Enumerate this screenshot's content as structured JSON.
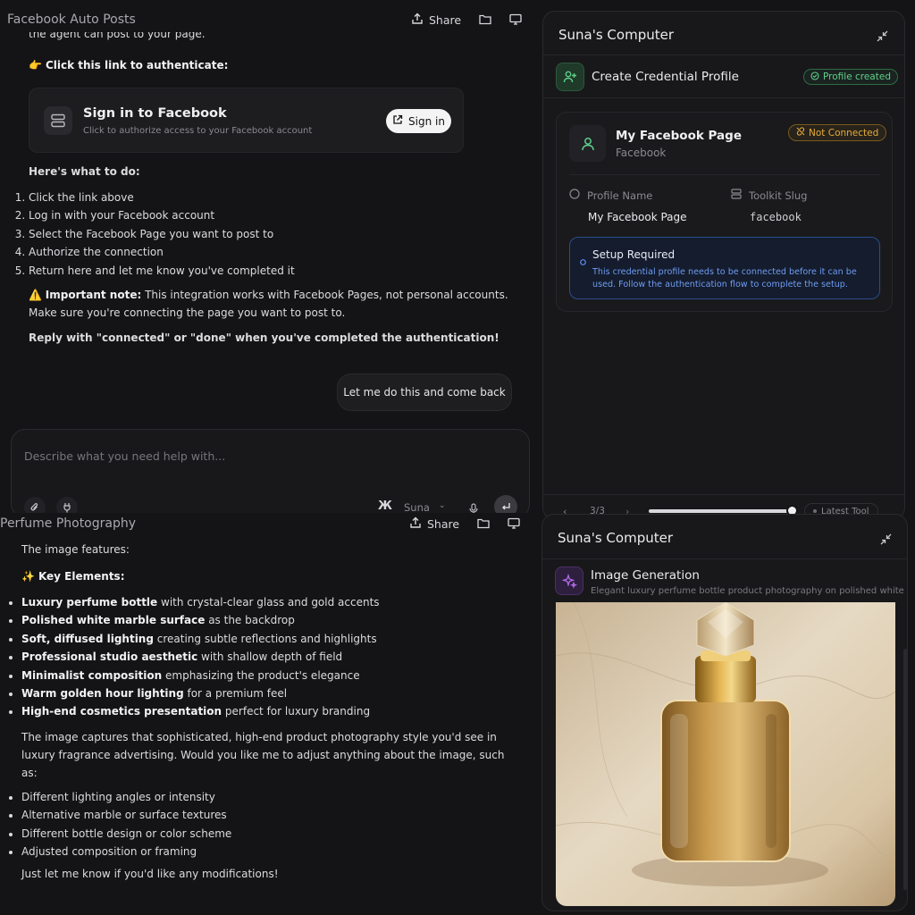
{
  "top": {
    "title": "Facebook Auto Posts",
    "share_label": "Share",
    "clipped_line": "the agent can post to your page.",
    "auth_prompt": "Click this link to authenticate:",
    "auth_card": {
      "title": "Sign in to Facebook",
      "subtitle": "Click to authorize access to your Facebook account",
      "button": "Sign in"
    },
    "steps_heading": "Here's what to do:",
    "steps": [
      "Click the link above",
      "Log in with your Facebook account",
      "Select the Facebook Page you want to post to",
      "Authorize the connection",
      "Return here and let me know you've completed it"
    ],
    "note_label": "Important note:",
    "note_text": " This integration works with Facebook Pages, not personal accounts.",
    "note_text2": "Make sure you're connecting the page you want to post to.",
    "reply_text": "Reply with \"connected\" or \"done\" when you've completed the authentication!",
    "user_message": "Let me do this and come back",
    "input_placeholder": "Describe what you need help with...",
    "model_name": "Suna"
  },
  "bottom": {
    "title": "Perfume Photography",
    "share_label": "Share",
    "intro": "The image features:",
    "key_heading": "Key Elements:",
    "key_items": [
      {
        "bold": "Luxury perfume bottle",
        "rest": " with crystal-clear glass and gold accents"
      },
      {
        "bold": "Polished white marble surface",
        "rest": " as the backdrop"
      },
      {
        "bold": "Soft, diffused lighting",
        "rest": " creating subtle reflections and highlights"
      },
      {
        "bold": "Professional studio aesthetic",
        "rest": " with shallow depth of field"
      },
      {
        "bold": "Minimalist composition",
        "rest": " emphasizing the product's elegance"
      },
      {
        "bold": "Warm golden hour lighting",
        "rest": " for a premium feel"
      },
      {
        "bold": "High-end cosmetics presentation",
        "rest": " perfect for luxury branding"
      }
    ],
    "para1": "The image captures that sophisticated, high-end product photography style you'd see in",
    "para2": "luxury fragrance advertising. Would you like me to adjust anything about the image, such",
    "para3": "as:",
    "options": [
      "Different lighting angles or intensity",
      "Alternative marble or surface textures",
      "Different bottle design or color scheme",
      "Adjusted composition or framing"
    ],
    "closing": "Just let me know if you'd like any modifications!"
  },
  "right_top": {
    "title": "Suna's Computer",
    "tool_name": "Create Credential Profile",
    "tool_status": "Profile created",
    "profile_name": "My Facebook Page",
    "profile_platform": "Facebook",
    "connection_status": "Not Connected",
    "field1_label": "Profile Name",
    "field1_value": "My Facebook Page",
    "field2_label": "Toolkit Slug",
    "field2_value": "facebook",
    "setup_title": "Setup Required",
    "setup_line1": "This credential profile needs to be connected before it can be",
    "setup_line2": "used. Follow the authentication flow to complete the setup.",
    "pager": "3/3",
    "latest_label": "Latest Tool",
    "progress": 1.0
  },
  "right_bottom": {
    "title": "Suna's Computer",
    "tool_name": "Image Generation",
    "tool_subtitle": "Elegant luxury perfume bottle product photography on polished white marble"
  },
  "colors": {
    "background": "#141416",
    "accent_green": "#5fd08a",
    "accent_amber": "#e5ac3b",
    "accent_blue": "#3b6fd8",
    "accent_purple": "#b06ae8"
  }
}
